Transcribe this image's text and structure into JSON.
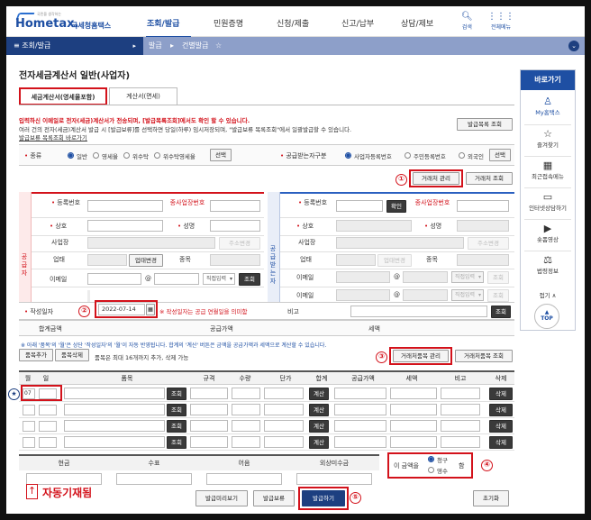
{
  "header": {
    "logo_text": "Hometax.",
    "logo_sub": "국세청홈택스",
    "logo_tagline": "국민을 생각하는",
    "nav": [
      "조회/발급",
      "민원증명",
      "신청/제출",
      "신고/납부",
      "상담/제보"
    ],
    "search_label": "검색",
    "allmenu_label": "전체메뉴"
  },
  "breadcrumb": {
    "menu": "조회/발급",
    "items": [
      "발급",
      "건별발급"
    ]
  },
  "quick": {
    "title": "바로가기",
    "items": [
      "My홈택스",
      "즐겨찾기",
      "최근접속메뉴",
      "인터넷상담하기",
      "숏폼영상",
      "법령정보"
    ],
    "fold": "접기 ∧",
    "top": "TOP"
  },
  "page": {
    "title": "전자세금계산서 일반(사업자)",
    "tabs": [
      "세금계산서(영세율포함)",
      "계산서(면세)"
    ],
    "notice_red": "입력하신 이메일로 전자(세금)계산서가 전송되며, [발급목록조회]에서도 확인 할 수 있습니다.",
    "notice_black": "여러 건의 전자(세금)계산서 발급 시 [발급보류]를 선택하면 당일(하루) 임시저장되며, \"발급보류 목록조회\"에서 일괄발급할 수 있습니다.",
    "notice_link": "발급보류 목록조회 바로가기",
    "list_button": "발급목록 조회"
  },
  "type_row": {
    "label": "종류",
    "options": [
      "일반",
      "영세율",
      "위수탁",
      "위수탁영세율"
    ],
    "select_button": "선택",
    "receiver_label": "공급받는자구분",
    "receiver_options": [
      "사업자등록번호",
      "주민등록번호",
      "외국인"
    ],
    "receiver_select": "선택"
  },
  "partner_buttons": {
    "manage": "거래처 관리",
    "lookup": "거래처 조회"
  },
  "supplier": {
    "side": "공급자",
    "fields": [
      "등록번호",
      "종사업장번호",
      "상호",
      "성명",
      "사업장",
      "업태",
      "종목",
      "이메일"
    ],
    "addr_button": "주소변경",
    "biz_button": "업태변경",
    "email_at": "@",
    "email_select": "직접입력",
    "lookup": "조회"
  },
  "receiver": {
    "side": "공급받는자",
    "confirm": "확인",
    "addr_button": "주소변경",
    "biz_button": "업태변경",
    "email_select": "직접입력",
    "lookup": "조회"
  },
  "date_row": {
    "label": "작성일자",
    "value": "2022-07-14",
    "note": "※ 작성일자는 공급 연월일을 의미함",
    "memo_label": "비고",
    "memo_lookup": "조회"
  },
  "sum_row": [
    "합계금액",
    "공급가액",
    "세액"
  ],
  "item_notice": "※ 아래 '품목'의 '월'은 상단 '작성일자'의 '월'이 자동 반영됩니다. 합계의 '계산' 버튼은 금액을 공급가액과 세액으로 계산할 수 있습니다.",
  "item_buttons": {
    "add": "품목추가",
    "delete": "품목삭제",
    "note": "품목은 최대 16개까지 추가, 삭제 가능",
    "manage": "거래처품목 관리",
    "lookup": "거래처품목 조회"
  },
  "table": {
    "headers": [
      "월",
      "일",
      "품목",
      "규격",
      "수량",
      "단가",
      "합계",
      "공급가액",
      "세액",
      "비고",
      "삭제"
    ],
    "first_month": "07",
    "row_lookup": "조회",
    "row_calc": "계산",
    "row_delete": "삭제"
  },
  "totals": {
    "headers": [
      "현금",
      "수표",
      "어음",
      "외상미수금"
    ]
  },
  "claim": {
    "prefix": "이 금액을",
    "opt1": "청구",
    "opt2": "영수",
    "suffix": "함"
  },
  "auto_note": "자동기재됨",
  "footer_buttons": [
    "발급미리보기",
    "발급보류",
    "발급하기",
    "초기화"
  ],
  "markers": [
    "①",
    "②",
    "③",
    "④",
    "⑤",
    "★"
  ],
  "colors": {
    "accent_red": "#d3121b",
    "navy": "#1d3f80",
    "brand_blue": "#1e4fa3"
  }
}
